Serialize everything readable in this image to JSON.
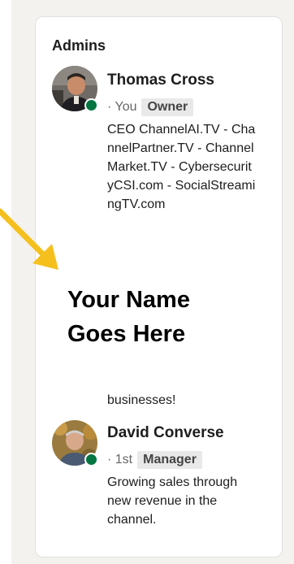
{
  "group": {
    "section_title": "Admins",
    "admins": [
      {
        "name": "Thomas Cross",
        "connection": "· You",
        "role": "Owner",
        "headline": "CEO ChannelAI.TV - ChannelPartner.TV - ChannelMarket.TV - CybersecurityCSI.com - SocialStreamingTV.com",
        "online": true
      },
      {
        "name": "David Converse",
        "connection": "· 1st",
        "role": "Manager",
        "headline": "Growing sales through new revenue in the channel.",
        "online": true
      }
    ],
    "hidden_headline_tail": "businesses!"
  },
  "overlay": {
    "line1": "Your Name",
    "line2": "Goes Here"
  },
  "colors": {
    "online": "#057642",
    "arrow": "#f5c01e",
    "badge_bg": "#e9e9e9"
  }
}
